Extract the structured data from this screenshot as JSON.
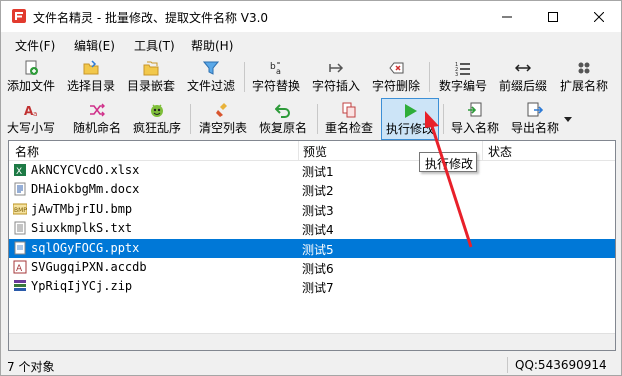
{
  "window": {
    "title": "文件名精灵 - 批量修改、提取文件名称  V3.0"
  },
  "menu": [
    "文件(F)",
    "编辑(E)",
    "工具(T)",
    "帮助(H)"
  ],
  "toolbar_row1": [
    {
      "label": "添加文件",
      "icon": "add-file-icon"
    },
    {
      "label": "选择目录",
      "icon": "folder-icon"
    },
    {
      "label": "目录嵌套",
      "icon": "nested-folder-icon"
    },
    {
      "label": "文件过滤",
      "icon": "filter-icon"
    },
    {
      "label": "字符替换",
      "icon": "replace-icon"
    },
    {
      "label": "字符插入",
      "icon": "insert-icon"
    },
    {
      "label": "字符删除",
      "icon": "delete-icon"
    },
    {
      "label": "数字编号",
      "icon": "numbering-icon"
    },
    {
      "label": "前缀后缀",
      "icon": "prefix-suffix-icon"
    },
    {
      "label": "扩展名称",
      "icon": "extension-icon"
    }
  ],
  "toolbar_row2": [
    {
      "label": "大写小写",
      "icon": "case-icon"
    },
    {
      "label": "随机命名",
      "icon": "shuffle-icon"
    },
    {
      "label": "疯狂乱序",
      "icon": "crazy-icon"
    },
    {
      "label": "清空列表",
      "icon": "clear-icon"
    },
    {
      "label": "恢复原名",
      "icon": "undo-icon"
    },
    {
      "label": "重名检查",
      "icon": "check-duplicate-icon"
    },
    {
      "label": "执行修改",
      "icon": "play-icon"
    },
    {
      "label": "导入名称",
      "icon": "import-icon"
    },
    {
      "label": "导出名称",
      "icon": "export-icon"
    }
  ],
  "list": {
    "columns": [
      "名称",
      "预览",
      "状态"
    ],
    "rows": [
      {
        "name": "AkNCYCVcdO.xlsx",
        "preview": "测试1",
        "type": "excel"
      },
      {
        "name": "DHAiokbgMm.docx",
        "preview": "测试2",
        "type": "word"
      },
      {
        "name": "jAwTMbjrIU.bmp",
        "preview": "测试3",
        "type": "bmp"
      },
      {
        "name": "SiuxkmplkS.txt",
        "preview": "测试4",
        "type": "txt"
      },
      {
        "name": "sqlOGyFOCG.pptx",
        "preview": "测试5",
        "type": "pptx",
        "selected": true
      },
      {
        "name": "SVGugqiPXN.accdb",
        "preview": "测试6",
        "type": "access"
      },
      {
        "name": "YpRiqIjYCj.zip",
        "preview": "测试7",
        "type": "zip"
      }
    ]
  },
  "tooltip": "执行修改",
  "status": {
    "count": "7 个对象",
    "qq": "QQ:543690914"
  },
  "colors": {
    "selection": "#0078d7",
    "annotation_arrow": "#e8202a"
  }
}
